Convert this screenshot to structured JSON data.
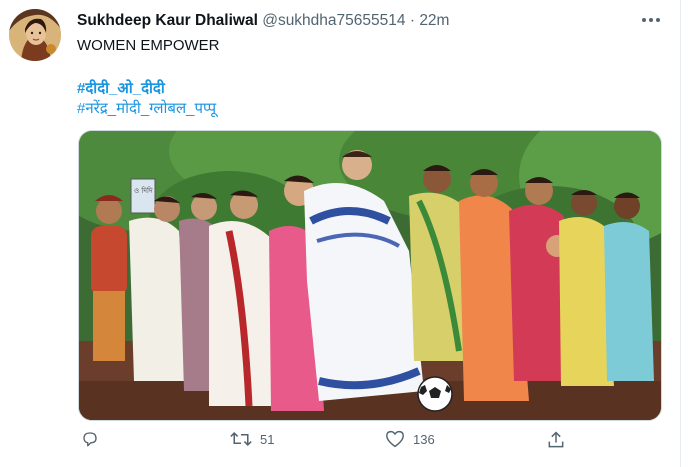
{
  "tweet": {
    "display_name": "Sukhdeep Kaur Dhaliwal",
    "handle": "@sukhdha75655514",
    "separator": "·",
    "time": "22m",
    "text": "WOMEN EMPOWER",
    "hashtags": [
      "#दीदी_ओ_दीदी",
      "#नरेंद्र_मोदी_ग्लोबल_पप्पू"
    ]
  },
  "actions": {
    "reply_count": "",
    "retweet_count": "51",
    "like_count": "136"
  },
  "media": {
    "sign_text": "ও দিদি"
  },
  "icons": {
    "more": "more-icon",
    "reply": "reply-icon",
    "retweet": "retweet-icon",
    "like": "like-icon",
    "share": "share-icon"
  },
  "colors": {
    "link": "#1b95e0",
    "muted": "#536471",
    "text": "#0f1419"
  }
}
